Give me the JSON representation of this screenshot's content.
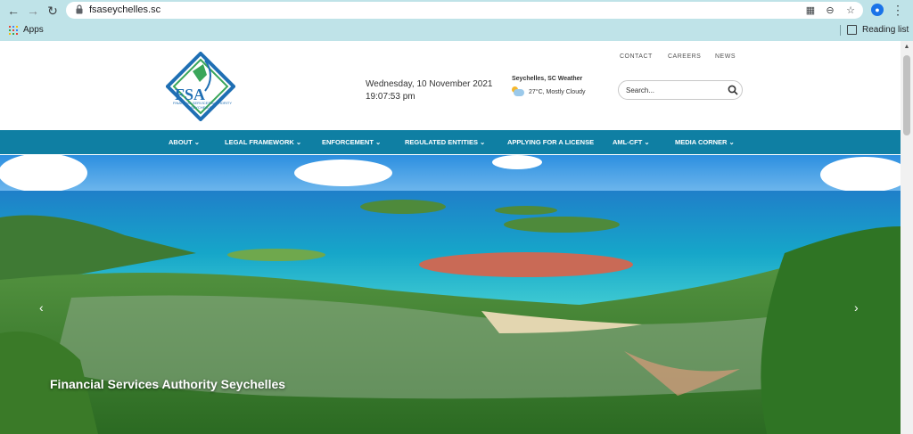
{
  "browser": {
    "url": "fsaseychelles.sc",
    "bookmarks": {
      "apps_label": "Apps",
      "reading_list_label": "Reading list"
    },
    "profile_initial": ""
  },
  "header": {
    "logo_text": "FSA",
    "logo_subtext": "FINANCIAL SERVICES AUTHORITY SEYCHELLES",
    "date_line": "Wednesday, 10 November 2021",
    "time_line": "19:07:53 pm",
    "weather": {
      "title": "Seychelles, SC Weather",
      "text": "27°C, Mostly Cloudy"
    },
    "links": [
      "CONTACT",
      "CAREERS",
      "NEWS"
    ],
    "search_placeholder": "Search..."
  },
  "nav": {
    "items": [
      {
        "label": "ABOUT ⌄"
      },
      {
        "label": "LEGAL FRAMEWORK ⌄"
      },
      {
        "label": "ENFORCEMENT ⌄"
      },
      {
        "label": "REGULATED ENTITIES ⌄"
      },
      {
        "label": "APPLYING FOR A LICENSE"
      },
      {
        "label": "AML-CFT ⌄"
      },
      {
        "label": "MEDIA CORNER ⌄"
      }
    ]
  },
  "hero": {
    "caption": "Financial Services Authority Seychelles",
    "prev_arrow": "‹",
    "next_arrow": "›"
  },
  "colors": {
    "chrome": "#bfe3e8",
    "nav": "#0f7fa3",
    "logo_blue": "#1f6fb4",
    "logo_green": "#3aa65a"
  }
}
